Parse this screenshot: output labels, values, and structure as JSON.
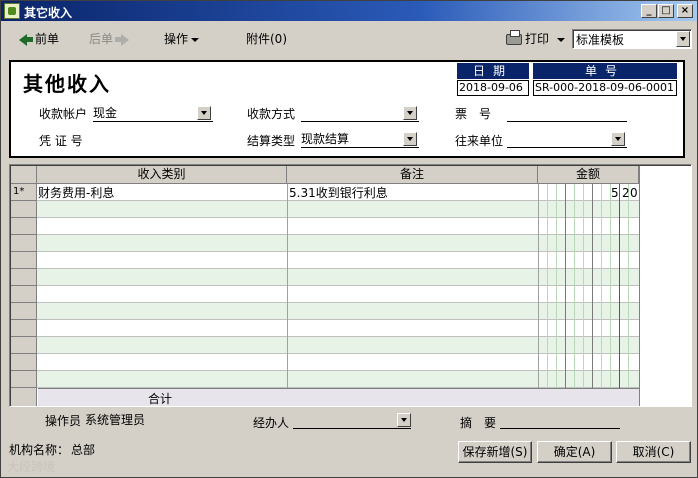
{
  "window": {
    "title": "其它收入",
    "min_label": "_",
    "max_label": "□",
    "close_label": "×"
  },
  "toolbar": {
    "prev_label": "前单",
    "next_label": "后单",
    "ops_label": "操作",
    "attach_label": "附件(0)",
    "print_label": "打印",
    "template_value": "标准模板"
  },
  "header": {
    "form_title": "其他收入",
    "date_label": "日期",
    "date_value": "2018-09-06",
    "docno_label": "单号",
    "docno_value": "SR-000-2018-09-06-0001",
    "account_label": "收款帐户",
    "account_value": "现金",
    "pay_method_label": "收款方式",
    "pay_method_value": "",
    "ticket_label": "票　号",
    "ticket_value": "",
    "voucher_label": "凭 证 号",
    "voucher_value": "",
    "settle_type_label": "结算类型",
    "settle_type_value": "现款结算",
    "partner_label": "往来单位",
    "partner_value": ""
  },
  "grid": {
    "columns": [
      "收入类别",
      "备注",
      "金额"
    ],
    "rows": [
      {
        "row_no": "1*",
        "category": "财务费用-利息",
        "note": "5.31收到银行利息",
        "amount_digits": [
          "5",
          "2",
          "0"
        ]
      }
    ],
    "total_label": "合计"
  },
  "footer": {
    "operator_label": "操作员",
    "operator_value": "系统管理员",
    "handler_label": "经办人",
    "handler_value": "",
    "summary_label": "摘　要",
    "summary_value": "",
    "org_label": "机构名称：",
    "org_value": "总部",
    "save_new_label": "保存新增(S)",
    "ok_label": "确定(A)",
    "cancel_label": "取消(C)",
    "watermark": "大段跨境"
  }
}
